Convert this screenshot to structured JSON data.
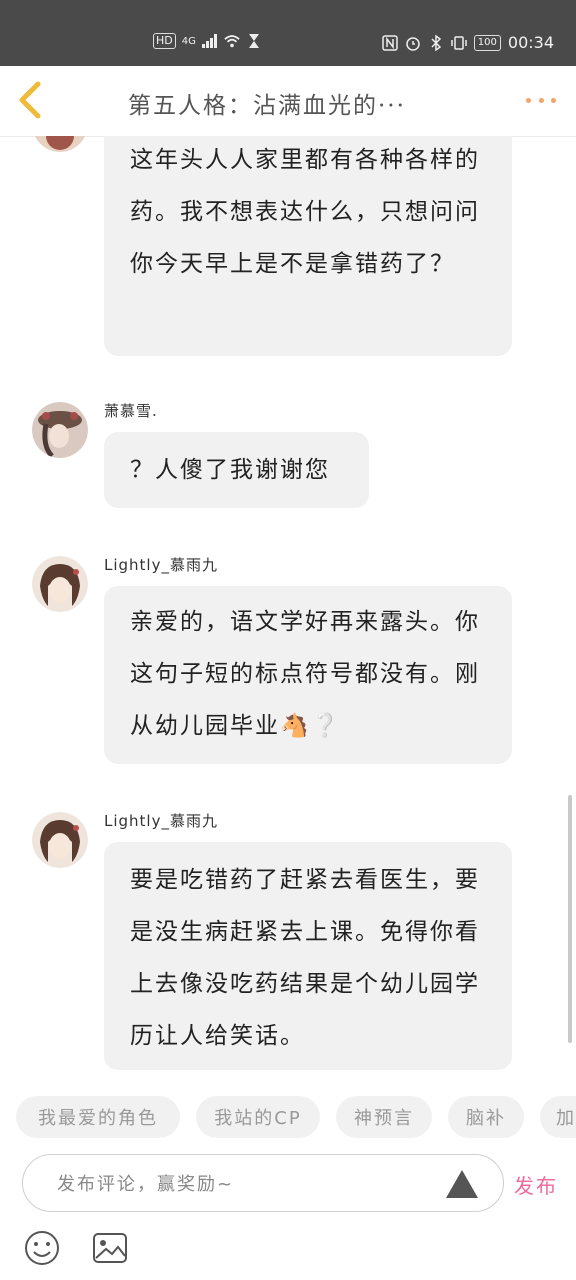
{
  "status": {
    "hd": "HD",
    "net": "4G",
    "time": "00:34",
    "battery": "100"
  },
  "header": {
    "title": "第五人格：沾满血光的···"
  },
  "comments": [
    {
      "text": "这年头人人家里都有各种各样的药。我不想表达什么，只想问问你今天早上是不是拿错药了？"
    },
    {
      "user": "萧慕雪.",
      "text": "？人傻了我谢谢您"
    },
    {
      "user": "Lightly_慕雨九",
      "text": "亲爱的，语文学好再来露头。你这句子短的标点符号都没有。刚从幼儿园毕业🐴❔"
    },
    {
      "user": "Lightly_慕雨九",
      "text": "要是吃错药了赶紧去看医生，要是没生病赶紧去上课。免得你看上去像没吃药结果是个幼儿园学历让人给笑话。"
    }
  ],
  "tags": [
    "我最爱的角色",
    "我站的CP",
    "神预言",
    "脑补",
    "加"
  ],
  "composer": {
    "placeholder": "发布评论，赢奖励~",
    "publish_label": "发布"
  },
  "colors": {
    "accent_orange": "#f3a36b",
    "publish_pink": "#f06a9b",
    "bubble_bg": "#f1f1f1",
    "status_bg": "#4a4a4a"
  }
}
